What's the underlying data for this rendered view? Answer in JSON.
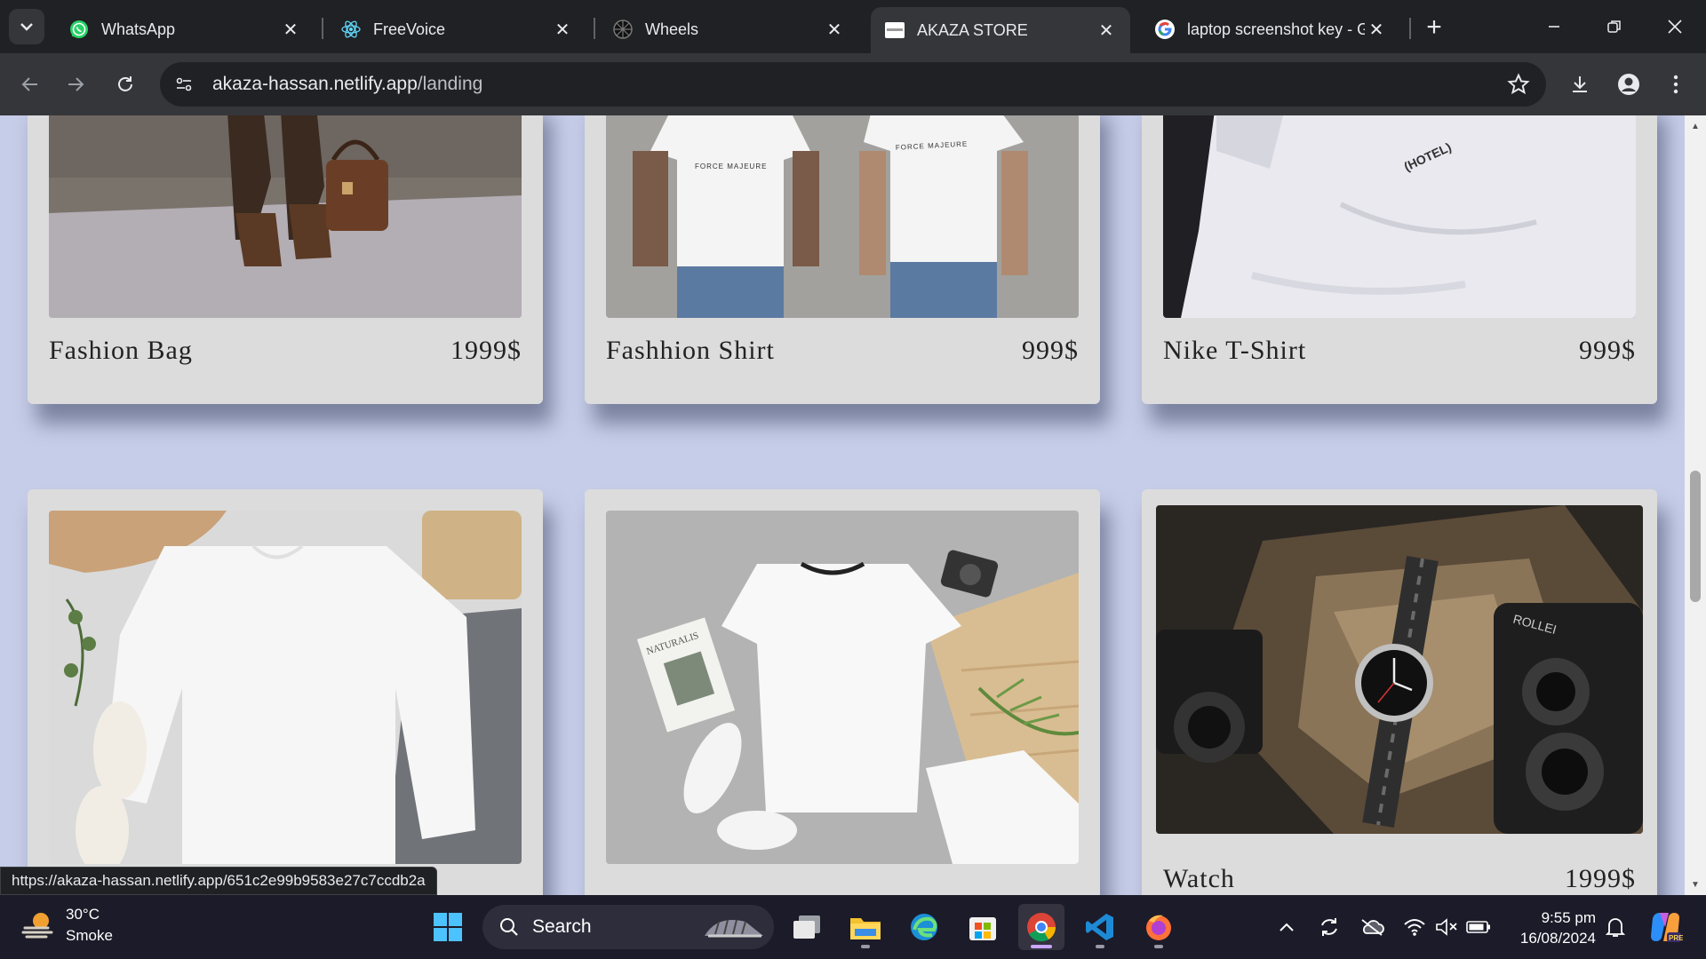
{
  "browser": {
    "tabs": [
      {
        "title": "WhatsApp",
        "icon": "whatsapp-icon",
        "active": false
      },
      {
        "title": "FreeVoice",
        "icon": "react-icon",
        "active": false
      },
      {
        "title": "Wheels",
        "icon": "wheels-icon",
        "active": false
      },
      {
        "title": "AKAZA STORE",
        "icon": "akaza-store-icon",
        "active": true
      },
      {
        "title": "laptop screenshot key - G",
        "icon": "google-icon",
        "active": false
      }
    ],
    "close_glyph": "✕",
    "new_tab_glyph": "+",
    "url_host": "akaza-hassan.netlify.app",
    "url_path": "/landing",
    "status_url": "https://akaza-hassan.netlify.app/651c2e99b9583e27c7ccdb2a"
  },
  "products": [
    {
      "name": "Fashion Bag",
      "price": "1999$"
    },
    {
      "name": "Fashhion Shirt",
      "price": "999$"
    },
    {
      "name": "Nike T-Shirt",
      "price": "999$"
    },
    {
      "name": "",
      "price": ""
    },
    {
      "name": "",
      "price": ""
    },
    {
      "name": "Watch",
      "price": "1999$"
    }
  ],
  "image_texts": {
    "shirt_print": "FORCE MAJEURE",
    "hotel_print": "(HOTEL)",
    "magazine": "NATURALIS",
    "camera_brand": "ROLLEI"
  },
  "taskbar": {
    "weather_temp": "30°C",
    "weather_desc": "Smoke",
    "search_label": "Search",
    "time": "9:55 pm",
    "date": "16/08/2024"
  },
  "colors": {
    "page_bg": "#c6cde8",
    "card_bg": "#dcdcdc",
    "browser_dark": "#202124",
    "toolbar": "#35363a",
    "taskbar": "#1c1b29"
  }
}
